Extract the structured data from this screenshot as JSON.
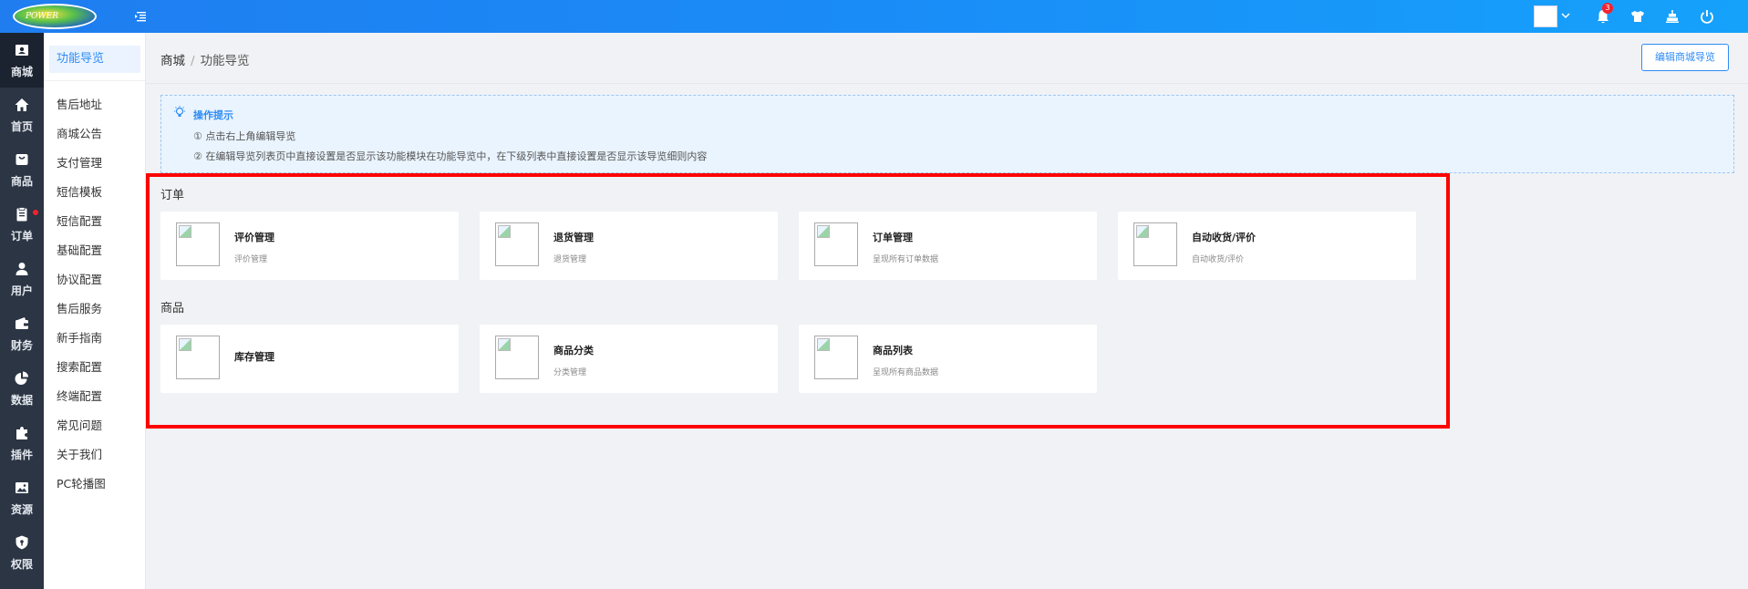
{
  "header": {
    "logo_text": "POWER",
    "notification_count": "3"
  },
  "leftnav": [
    {
      "label": "商城",
      "icon": "store-icon",
      "active": true
    },
    {
      "label": "首页",
      "icon": "home-icon"
    },
    {
      "label": "商品",
      "icon": "goods-icon"
    },
    {
      "label": "订单",
      "icon": "order-icon",
      "dot": true
    },
    {
      "label": "用户",
      "icon": "user-icon"
    },
    {
      "label": "财务",
      "icon": "wallet-icon"
    },
    {
      "label": "数据",
      "icon": "chart-icon"
    },
    {
      "label": "插件",
      "icon": "plugin-icon"
    },
    {
      "label": "资源",
      "icon": "image-icon"
    },
    {
      "label": "权限",
      "icon": "shield-icon"
    }
  ],
  "subnav": {
    "active": "功能导览",
    "items": [
      "售后地址",
      "商城公告",
      "支付管理",
      "短信模板",
      "短信配置",
      "基础配置",
      "协议配置",
      "售后服务",
      "新手指南",
      "搜索配置",
      "终端配置",
      "常见问题",
      "关于我们",
      "PC轮播图"
    ]
  },
  "breadcrumb": {
    "root": "商城",
    "separator": "/",
    "current": "功能导览"
  },
  "edit_button": "编辑商城导览",
  "tips": {
    "title": "操作提示",
    "lines": [
      "① 点击右上角编辑导览",
      "② 在编辑导览列表页中直接设置是否显示该功能模块在功能导览中，在下级列表中直接设置是否显示该导览细则内容"
    ]
  },
  "sections": [
    {
      "title": "订单",
      "cards": [
        {
          "title": "评价管理",
          "sub": "评价管理"
        },
        {
          "title": "退货管理",
          "sub": "退货管理"
        },
        {
          "title": "订单管理",
          "sub": "呈现所有订单数据"
        },
        {
          "title": "自动收货/评价",
          "sub": "自动收货/评价"
        }
      ]
    },
    {
      "title": "商品",
      "cards": [
        {
          "title": "库存管理",
          "sub": ""
        },
        {
          "title": "商品分类",
          "sub": "分类管理"
        },
        {
          "title": "商品列表",
          "sub": "呈现所有商品数据"
        }
      ]
    }
  ]
}
